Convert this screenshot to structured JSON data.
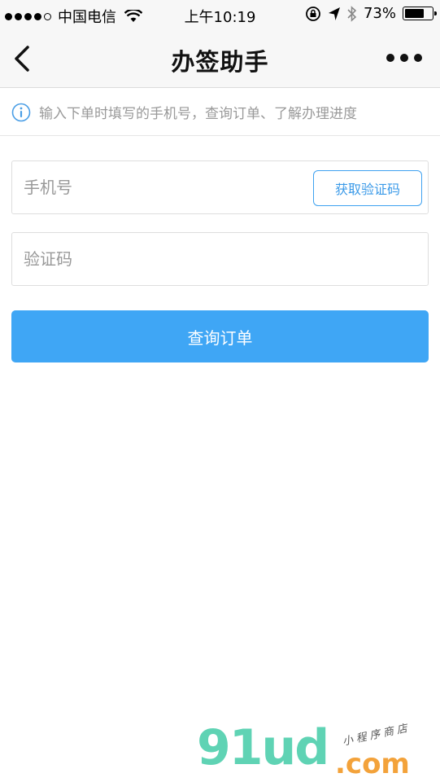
{
  "status_bar": {
    "carrier": "中国电信",
    "time": "上午10:19",
    "battery_percent": "73%",
    "battery_level": 0.73,
    "icons": [
      "signal-dots-icon",
      "wifi-icon",
      "rotation-lock-icon",
      "location-arrow-icon",
      "bluetooth-icon",
      "battery-icon"
    ]
  },
  "nav": {
    "title": "办签助手",
    "back_icon": "chevron-left-icon",
    "more_icon": "more-dots-icon"
  },
  "notice": {
    "icon": "info-icon",
    "text": "输入下单时填写的手机号，查询订单、了解办理进度"
  },
  "form": {
    "phone_placeholder": "手机号",
    "phone_value": "",
    "get_code_label": "获取验证码",
    "code_placeholder": "验证码",
    "code_value": "",
    "submit_label": "查询订单"
  },
  "watermark": {
    "logo": "91ud",
    "domain": ".com",
    "tagline": "小程序商店"
  },
  "colors": {
    "primary": "#3fa6f5",
    "notice_text": "#999999",
    "watermark_green": "#5fd3b4",
    "watermark_orange": "#f3a23a"
  }
}
